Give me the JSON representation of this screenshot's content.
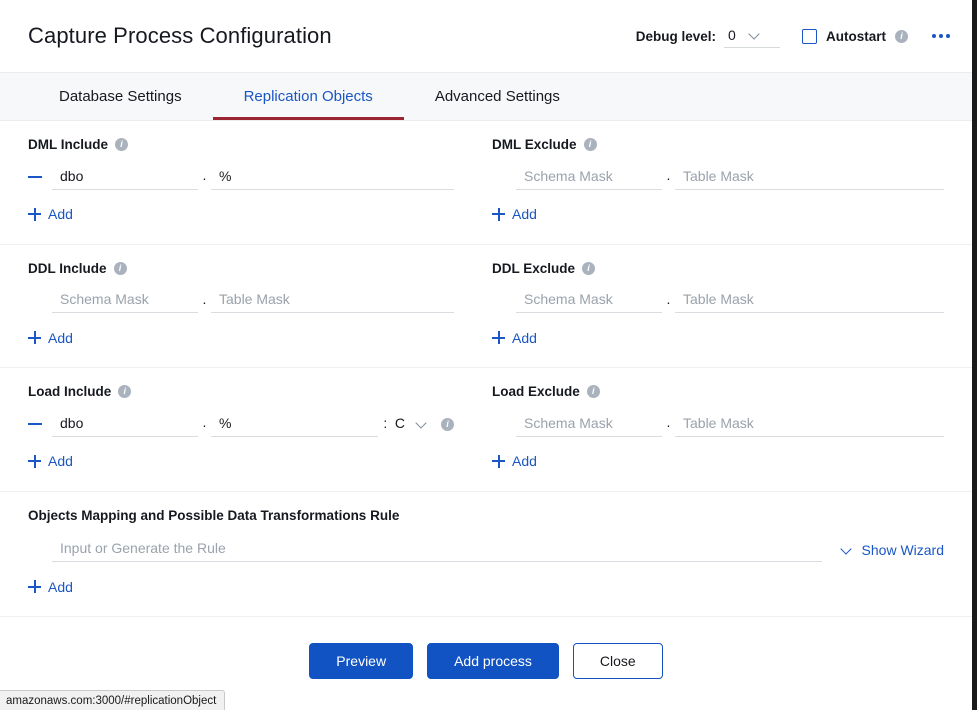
{
  "header": {
    "title": "Capture Process Configuration",
    "debug_label": "Debug level:",
    "debug_value": "0",
    "autostart_label": "Autostart",
    "info_glyph": "i",
    "menu_icon": "kebab-menu-icon"
  },
  "tabs": [
    {
      "label": "Database Settings",
      "active": false
    },
    {
      "label": "Replication Objects",
      "active": true
    },
    {
      "label": "Advanced Settings",
      "active": false
    }
  ],
  "placeholders": {
    "schema_mask": "Schema Mask",
    "table_mask": "Table Mask",
    "rule": "Input or Generate the Rule"
  },
  "separators": {
    "dot": ".",
    "colon": ":"
  },
  "add_label": "Add",
  "sections": [
    {
      "id": "dml",
      "include": {
        "label": "DML Include",
        "has_remove": true,
        "schema_value": "dbo",
        "table_value": "%",
        "add_label": "Add"
      },
      "exclude": {
        "label": "DML Exclude",
        "has_remove": false,
        "schema_value": "",
        "table_value": "",
        "add_label": "Add"
      }
    },
    {
      "id": "ddl",
      "include": {
        "label": "DDL Include",
        "has_remove": false,
        "schema_value": "",
        "table_value": "",
        "add_label": "Add"
      },
      "exclude": {
        "label": "DDL Exclude",
        "has_remove": false,
        "schema_value": "",
        "table_value": "",
        "add_label": "Add"
      }
    },
    {
      "id": "load",
      "include": {
        "label": "Load Include",
        "has_remove": true,
        "schema_value": "dbo",
        "table_value": "%",
        "extra_select_value": "C",
        "add_label": "Add"
      },
      "exclude": {
        "label": "Load Exclude",
        "has_remove": false,
        "schema_value": "",
        "table_value": "",
        "add_label": "Add"
      }
    }
  ],
  "rule_section": {
    "label": "Objects Mapping and Possible Data Transformations Rule",
    "input_value": "",
    "wizard_label": "Show Wizard",
    "add_label": "Add"
  },
  "footer": {
    "preview_label": "Preview",
    "add_process_label": "Add process",
    "close_label": "Close"
  },
  "statusbar": {
    "url": "amazonaws.com:3000/#replicationObject"
  },
  "colors": {
    "accent_blue": "#1a56c4",
    "button_blue": "#1253c4",
    "active_tab_underline": "#9c2533",
    "placeholder_gray": "#9aa2ac",
    "tabbar_bg": "#f7f8f9"
  }
}
